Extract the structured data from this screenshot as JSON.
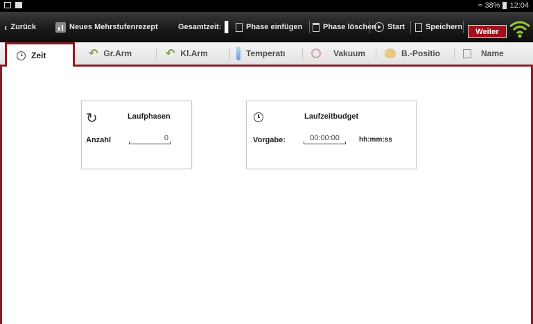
{
  "status_bar": {
    "signal_text": "38%",
    "time": "12:04",
    "icons": [
      "screenshot-icon",
      "notification-icon",
      "wifi-signal-icon",
      "battery-icon"
    ]
  },
  "toolbar": {
    "back_label": "Zurück",
    "title": "Neues Mehrstufenrezept",
    "total_time_label": "Gesamtzeit:",
    "insert_phase_label": "Phase einfügen",
    "delete_phase_label": "Phase löschen",
    "start_label": "Start",
    "save_label": "Speichern",
    "next_label": "Weiter",
    "accent_color": "#a3101a"
  },
  "tabs": [
    {
      "label": "Zeit",
      "icon": "clock-icon",
      "active": true
    },
    {
      "label": "Gr.Arm",
      "icon": "large-arm-icon",
      "active": false
    },
    {
      "label": "Kl.Arm",
      "icon": "small-arm-icon",
      "active": false
    },
    {
      "label": "Temperatı",
      "icon": "thermometer-icon",
      "active": false
    },
    {
      "label": "Vakuum",
      "icon": "vacuum-icon",
      "active": false
    },
    {
      "label": "B.-Positio",
      "icon": "position-icon",
      "active": false
    },
    {
      "label": "Name",
      "icon": "save-disk-icon",
      "active": false
    }
  ],
  "cards": {
    "run_phases": {
      "title": "Laufphasen",
      "count_label": "Anzahl",
      "count_value": "0",
      "icon": "refresh-icon"
    },
    "runtime_budget": {
      "title": "Laufzeitbudget",
      "target_label": "Vorgabe:",
      "target_value": "00:00:00",
      "unit": "hh:mm:ss",
      "icon": "clock-icon"
    }
  },
  "theme": {
    "border_color": "#8e1b22"
  }
}
